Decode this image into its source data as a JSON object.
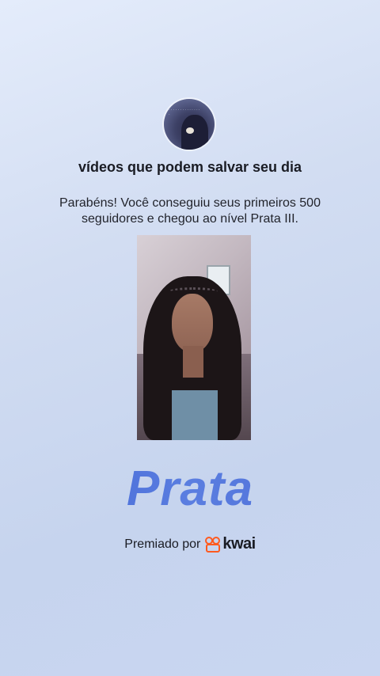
{
  "header": {
    "title": "vídeos que podem salvar seu dia",
    "avatar_icon": "profile-avatar-icon"
  },
  "message": {
    "text": "Parabéns! Você conseguiu seus primeiros 500 seguidores e chegou ao nível Prata III."
  },
  "video": {
    "thumbnail_icon": "video-thumbnail"
  },
  "level": {
    "name": "Prata",
    "color": "#4f71d9"
  },
  "footer": {
    "awarded_label": "Premiado por",
    "brand_name": "kwai",
    "brand_color": "#ff5a1f"
  }
}
